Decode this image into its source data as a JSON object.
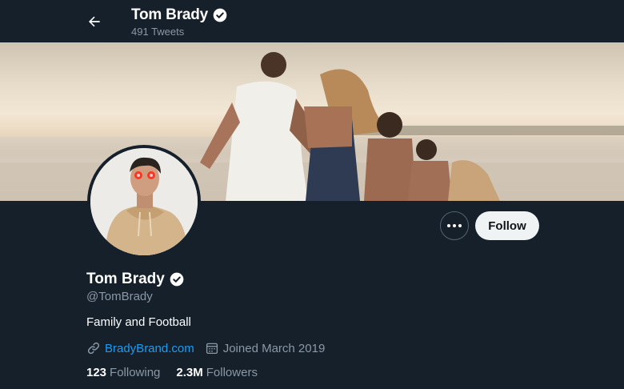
{
  "header": {
    "name": "Tom Brady",
    "tweet_count": "491 Tweets"
  },
  "profile": {
    "name": "Tom Brady",
    "handle": "@TomBrady",
    "bio": "Family and Football",
    "website": "BradyBrand.com",
    "joined": "Joined March 2019",
    "following_count": "123",
    "following_label": "Following",
    "followers_count": "2.3M",
    "followers_label": "Followers"
  },
  "actions": {
    "follow_label": "Follow"
  },
  "icons": {
    "back": "arrow-left-icon",
    "verified": "verified-badge-icon",
    "more": "more-icon",
    "link": "link-icon",
    "calendar": "calendar-icon"
  },
  "colors": {
    "background": "#15202b",
    "accent": "#1d9bf0",
    "secondary_text": "#8b98a5",
    "follow_button": "#eff3f4"
  }
}
